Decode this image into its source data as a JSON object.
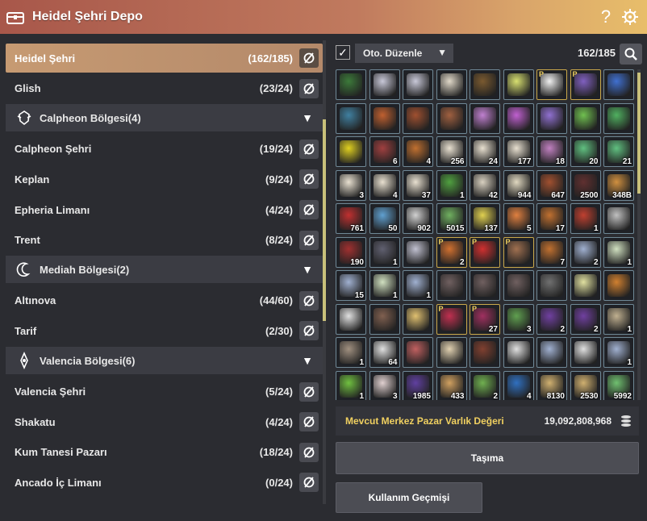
{
  "window": {
    "title": "Heidel Şehri Depo"
  },
  "locations": [
    {
      "kind": "loc",
      "name": "Heidel Şehri",
      "count": "(162/185)",
      "active": true
    },
    {
      "kind": "loc",
      "name": "Glish",
      "count": "(23/24)"
    },
    {
      "kind": "region",
      "name": "Calpheon Bölgesi(4)",
      "icon": "helmet-icon"
    },
    {
      "kind": "loc",
      "name": "Calpheon Şehri",
      "count": "(19/24)"
    },
    {
      "kind": "loc",
      "name": "Keplan",
      "count": "(9/24)"
    },
    {
      "kind": "loc",
      "name": "Epheria Limanı",
      "count": "(4/24)"
    },
    {
      "kind": "loc",
      "name": "Trent",
      "count": "(8/24)"
    },
    {
      "kind": "region",
      "name": "Mediah Bölgesi(2)",
      "icon": "crescent-icon"
    },
    {
      "kind": "loc",
      "name": "Altınova",
      "count": "(44/60)"
    },
    {
      "kind": "loc",
      "name": "Tarif",
      "count": "(2/30)"
    },
    {
      "kind": "region",
      "name": "Valencia Bölgesi(6)",
      "icon": "compass-icon"
    },
    {
      "kind": "loc",
      "name": "Valencia Şehri",
      "count": "(5/24)"
    },
    {
      "kind": "loc",
      "name": "Shakatu",
      "count": "(4/24)"
    },
    {
      "kind": "loc",
      "name": "Kum Tanesi Pazarı",
      "count": "(18/24)"
    },
    {
      "kind": "loc",
      "name": "Ancado İç Limanı",
      "count": "(0/24)"
    }
  ],
  "storage": {
    "auto_sort_checked": true,
    "auto_sort_label": "Oto. Düzenle",
    "slot_count": "162/185"
  },
  "items": [
    {
      "c": "#3c7a3a",
      "q": "",
      "p": ""
    },
    {
      "c": "#c8c8d8",
      "q": "",
      "p": ""
    },
    {
      "c": "#c8c8d8",
      "q": "",
      "p": ""
    },
    {
      "c": "#e0d8c8",
      "q": "",
      "p": ""
    },
    {
      "c": "#7a5a30",
      "q": "",
      "p": ""
    },
    {
      "c": "#d8e070",
      "q": "",
      "p": ""
    },
    {
      "c": "#f0f0f0",
      "q": "",
      "p": "P"
    },
    {
      "c": "#8060c0",
      "q": "",
      "p": "P"
    },
    {
      "c": "#4070d0",
      "q": "",
      "p": ""
    },
    {
      "c": "#4080a0",
      "q": "",
      "p": ""
    },
    {
      "c": "#c06030",
      "q": "",
      "p": ""
    },
    {
      "c": "#a05030",
      "q": "",
      "p": ""
    },
    {
      "c": "#a06040",
      "q": "",
      "p": ""
    },
    {
      "c": "#c080d0",
      "q": "",
      "p": ""
    },
    {
      "c": "#c060d0",
      "q": "",
      "p": ""
    },
    {
      "c": "#9070d0",
      "q": "",
      "p": ""
    },
    {
      "c": "#70c050",
      "q": "",
      "p": ""
    },
    {
      "c": "#50b060",
      "q": "",
      "p": ""
    },
    {
      "c": "#e0d020",
      "q": "",
      "p": ""
    },
    {
      "c": "#a04040",
      "q": "6",
      "p": ""
    },
    {
      "c": "#c07030",
      "q": "4",
      "p": ""
    },
    {
      "c": "#e8e0d0",
      "q": "256",
      "p": ""
    },
    {
      "c": "#e8e0d0",
      "q": "24",
      "p": ""
    },
    {
      "c": "#e8e0d0",
      "q": "177",
      "p": ""
    },
    {
      "c": "#c080c0",
      "q": "18",
      "p": ""
    },
    {
      "c": "#60c080",
      "q": "20",
      "p": ""
    },
    {
      "c": "#60c080",
      "q": "21",
      "p": ""
    },
    {
      "c": "#e8e0d0",
      "q": "3",
      "p": ""
    },
    {
      "c": "#e8e0d0",
      "q": "4",
      "p": ""
    },
    {
      "c": "#e8e0d0",
      "q": "37",
      "p": ""
    },
    {
      "c": "#50a040",
      "q": "1",
      "p": ""
    },
    {
      "c": "#d8d0c0",
      "q": "42",
      "p": ""
    },
    {
      "c": "#e0d8c0",
      "q": "944",
      "p": ""
    },
    {
      "c": "#a05030",
      "q": "647",
      "p": ""
    },
    {
      "c": "#603030",
      "q": "2500",
      "p": ""
    },
    {
      "c": "#d09040",
      "q": "348B",
      "p": ""
    },
    {
      "c": "#c03030",
      "q": "761",
      "p": ""
    },
    {
      "c": "#60a0d0",
      "q": "50",
      "p": ""
    },
    {
      "c": "#d0d0d0",
      "q": "902",
      "p": ""
    },
    {
      "c": "#70b060",
      "q": "5015",
      "p": ""
    },
    {
      "c": "#e0d050",
      "q": "137",
      "p": ""
    },
    {
      "c": "#e08040",
      "q": "5",
      "p": ""
    },
    {
      "c": "#c07030",
      "q": "17",
      "p": ""
    },
    {
      "c": "#c04030",
      "q": "1",
      "p": ""
    },
    {
      "c": "#c0c0c0",
      "q": "",
      "p": ""
    },
    {
      "c": "#a03030",
      "q": "190",
      "p": ""
    },
    {
      "c": "#606070",
      "q": "1",
      "p": ""
    },
    {
      "c": "#c0c0d0",
      "q": "",
      "p": ""
    },
    {
      "c": "#d07030",
      "q": "2",
      "p": "P"
    },
    {
      "c": "#d03030",
      "q": "",
      "p": "P"
    },
    {
      "c": "#a07050",
      "q": "",
      "p": "P"
    },
    {
      "c": "#c07030",
      "q": "7",
      "p": ""
    },
    {
      "c": "#a0b0d0",
      "q": "2",
      "p": ""
    },
    {
      "c": "#d0e0c0",
      "q": "1",
      "p": ""
    },
    {
      "c": "#a0b0d0",
      "q": "15",
      "p": ""
    },
    {
      "c": "#d0e0c0",
      "q": "1",
      "p": ""
    },
    {
      "c": "#a0b0d0",
      "q": "1",
      "p": ""
    },
    {
      "c": "#706060",
      "q": "",
      "p": ""
    },
    {
      "c": "#706060",
      "q": "",
      "p": ""
    },
    {
      "c": "#706060",
      "q": "",
      "p": ""
    },
    {
      "c": "#707070",
      "q": "",
      "p": ""
    },
    {
      "c": "#e0e0a0",
      "q": "",
      "p": ""
    },
    {
      "c": "#d08030",
      "q": "",
      "p": ""
    },
    {
      "c": "#e0e0e0",
      "q": "",
      "p": ""
    },
    {
      "c": "#806050",
      "q": "",
      "p": ""
    },
    {
      "c": "#e0c070",
      "q": "",
      "p": ""
    },
    {
      "c": "#c03050",
      "q": "",
      "p": "P"
    },
    {
      "c": "#a03060",
      "q": "27",
      "p": "P"
    },
    {
      "c": "#60a050",
      "q": "3",
      "p": ""
    },
    {
      "c": "#7040a0",
      "q": "2",
      "p": ""
    },
    {
      "c": "#7040a0",
      "q": "2",
      "p": ""
    },
    {
      "c": "#c0b090",
      "q": "1",
      "p": ""
    },
    {
      "c": "#a09080",
      "q": "1",
      "p": ""
    },
    {
      "c": "#e0e0e0",
      "q": "64",
      "p": ""
    },
    {
      "c": "#c06060",
      "q": "",
      "p": ""
    },
    {
      "c": "#e0d0b0",
      "q": "",
      "p": ""
    },
    {
      "c": "#804030",
      "q": "",
      "p": ""
    },
    {
      "c": "#e0e0e0",
      "q": "",
      "p": ""
    },
    {
      "c": "#a0b0d0",
      "q": "",
      "p": ""
    },
    {
      "c": "#e0e0e0",
      "q": "",
      "p": ""
    },
    {
      "c": "#a0b0d0",
      "q": "1",
      "p": ""
    },
    {
      "c": "#70c040",
      "q": "1",
      "p": ""
    },
    {
      "c": "#e0d0d0",
      "q": "3",
      "p": ""
    },
    {
      "c": "#6040a0",
      "q": "1985",
      "p": ""
    },
    {
      "c": "#d0a060",
      "q": "433",
      "p": ""
    },
    {
      "c": "#70b050",
      "q": "2",
      "p": ""
    },
    {
      "c": "#3070c0",
      "q": "4",
      "p": ""
    },
    {
      "c": "#d0b070",
      "q": "8130",
      "p": ""
    },
    {
      "c": "#d0b070",
      "q": "2530",
      "p": ""
    },
    {
      "c": "#70c070",
      "q": "5992",
      "p": ""
    }
  ],
  "market": {
    "label": "Mevcut Merkez Pazar Varlık Değeri",
    "amount": "19,092,808,968"
  },
  "buttons": {
    "transfer": "Taşıma",
    "history": "Kullanım Geçmişi"
  }
}
